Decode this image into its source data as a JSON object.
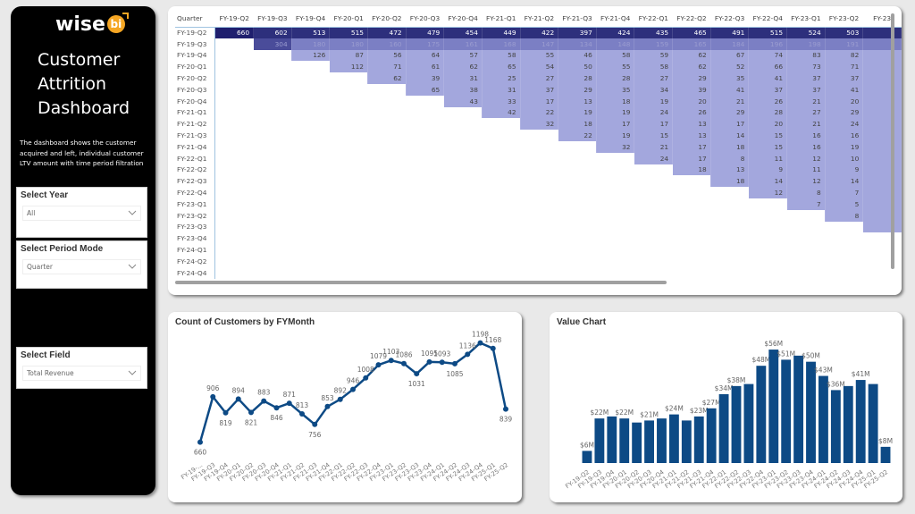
{
  "sidebar": {
    "logo_text": "wise",
    "logo_badge": "bi",
    "title_lines": [
      "Customer",
      "Attrition",
      "Dashboard"
    ],
    "description": "The dashboard shows the customer acquired and left, individual customer LTV amount with time period filtration",
    "slicers": [
      {
        "label": "Select Year",
        "value": "All"
      },
      {
        "label": "Select Period Mode",
        "value": "Quarter"
      },
      {
        "label": "Select Field",
        "value": "Total Revenue"
      }
    ]
  },
  "matrix": {
    "corner_label": "Quarter",
    "columns": [
      "FY-19-Q2",
      "FY-19-Q3",
      "FY-19-Q4",
      "FY-20-Q1",
      "FY-20-Q2",
      "FY-20-Q3",
      "FY-20-Q4",
      "FY-21-Q1",
      "FY-21-Q2",
      "FY-21-Q3",
      "FY-21-Q4",
      "FY-22-Q1",
      "FY-22-Q2",
      "FY-22-Q3",
      "FY-22-Q4",
      "FY-23-Q1",
      "FY-23-Q2",
      "FY-23"
    ],
    "rows": [
      {
        "label": "FY-19-Q2",
        "start": 0,
        "values": [
          660,
          602,
          513,
          515,
          472,
          479,
          454,
          449,
          422,
          397,
          424,
          435,
          465,
          491,
          515,
          524,
          503,
          ""
        ]
      },
      {
        "label": "FY-19-Q3",
        "start": 1,
        "values": [
          304,
          180,
          180,
          160,
          175,
          161,
          168,
          147,
          134,
          148,
          159,
          165,
          184,
          196,
          198,
          191,
          ""
        ]
      },
      {
        "label": "FY-19-Q4",
        "start": 2,
        "values": [
          126,
          87,
          56,
          64,
          57,
          58,
          55,
          46,
          58,
          59,
          62,
          67,
          74,
          83,
          82,
          ""
        ]
      },
      {
        "label": "FY-20-Q1",
        "start": 3,
        "values": [
          112,
          71,
          61,
          62,
          65,
          54,
          50,
          55,
          58,
          62,
          52,
          66,
          73,
          71,
          ""
        ]
      },
      {
        "label": "FY-20-Q2",
        "start": 4,
        "values": [
          62,
          39,
          31,
          25,
          27,
          28,
          28,
          27,
          29,
          35,
          41,
          37,
          37,
          ""
        ]
      },
      {
        "label": "FY-20-Q3",
        "start": 5,
        "values": [
          65,
          38,
          31,
          37,
          29,
          35,
          34,
          39,
          41,
          37,
          37,
          41,
          ""
        ]
      },
      {
        "label": "FY-20-Q4",
        "start": 6,
        "values": [
          43,
          33,
          17,
          13,
          18,
          19,
          20,
          21,
          26,
          21,
          20,
          ""
        ]
      },
      {
        "label": "FY-21-Q1",
        "start": 7,
        "values": [
          42,
          22,
          19,
          19,
          24,
          26,
          29,
          28,
          27,
          29,
          ""
        ]
      },
      {
        "label": "FY-21-Q2",
        "start": 8,
        "values": [
          32,
          18,
          17,
          17,
          13,
          17,
          20,
          21,
          24,
          ""
        ]
      },
      {
        "label": "FY-21-Q3",
        "start": 9,
        "values": [
          22,
          19,
          15,
          13,
          14,
          15,
          16,
          16,
          ""
        ]
      },
      {
        "label": "FY-21-Q4",
        "start": 10,
        "values": [
          32,
          21,
          17,
          18,
          15,
          16,
          19,
          ""
        ]
      },
      {
        "label": "FY-22-Q1",
        "start": 11,
        "values": [
          24,
          17,
          8,
          11,
          12,
          10,
          ""
        ]
      },
      {
        "label": "FY-22-Q2",
        "start": 12,
        "values": [
          18,
          13,
          9,
          11,
          9,
          ""
        ]
      },
      {
        "label": "FY-22-Q3",
        "start": 13,
        "values": [
          18,
          14,
          12,
          14,
          ""
        ]
      },
      {
        "label": "FY-22-Q4",
        "start": 14,
        "values": [
          12,
          8,
          7,
          ""
        ]
      },
      {
        "label": "FY-23-Q1",
        "start": 15,
        "values": [
          7,
          5,
          ""
        ]
      },
      {
        "label": "FY-23-Q2",
        "start": 16,
        "values": [
          8,
          ""
        ]
      },
      {
        "label": "FY-23-Q3",
        "start": 17,
        "values": [
          ""
        ]
      },
      {
        "label": "FY-23-Q4",
        "start": 18,
        "values": []
      },
      {
        "label": "FY-24-Q1",
        "start": 18,
        "values": []
      },
      {
        "label": "FY-24-Q2",
        "start": 18,
        "values": []
      },
      {
        "label": "FY-24-Q4",
        "start": 18,
        "values": []
      }
    ],
    "colors": {
      "max": "#1f1f6e",
      "high": "#3d3f8f",
      "mid": "#7b7fc4",
      "low": "#a3a7dd"
    }
  },
  "chart_data": [
    {
      "type": "line",
      "title": "Count of Customers by FYMonth",
      "xlabel": "",
      "ylabel": "",
      "categories": [
        "FY-19-...",
        "FY-19-Q3",
        "FY-19-Q4",
        "FY-20-Q1",
        "FY-20-Q2",
        "FY-20-Q3",
        "FY-20-Q4",
        "FY-21-Q1",
        "FY-21-Q2",
        "FY-21-Q3",
        "FY-21-Q4",
        "FY-22-Q1",
        "FY-22-Q2",
        "FY-22-Q3",
        "FY-22-Q4",
        "FY-23-Q1",
        "FY-23-Q2",
        "FY-23-Q3",
        "FY-23-Q4",
        "FY-24-Q1",
        "FY-24-Q2",
        "FY-24-Q3",
        "FY-24-Q4",
        "FY-25-Q1",
        "FY-25-Q2"
      ],
      "values": [
        660,
        906,
        819,
        894,
        821,
        883,
        846,
        871,
        813,
        756,
        853,
        892,
        946,
        1008,
        1079,
        1103,
        1086,
        1031,
        1095,
        1093,
        1085,
        1136,
        1198,
        1168,
        839
      ],
      "labels": [
        "660",
        "906",
        "819",
        "894",
        "821",
        "883",
        "846",
        "871",
        "813",
        "756",
        "853",
        "892",
        "946",
        "1008",
        "1079",
        "1103",
        "1086",
        "1031",
        "1095",
        "1093",
        "1085",
        "1136",
        "1198",
        "1168",
        "839"
      ],
      "ylim": [
        600,
        1230
      ],
      "color": "#0d4a85",
      "grid": false
    },
    {
      "type": "bar",
      "title": "Value Chart",
      "xlabel": "",
      "ylabel": "",
      "categories": [
        "FY-19-Q2",
        "FY-19-Q3",
        "FY-19-Q4",
        "FY-20-Q1",
        "FY-20-Q2",
        "FY-20-Q3",
        "FY-20-Q4",
        "FY-21-Q1",
        "FY-21-Q2",
        "FY-21-Q3",
        "FY-21-Q4",
        "FY-22-Q1",
        "FY-22-Q2",
        "FY-22-Q3",
        "FY-22-Q4",
        "FY-23-Q1",
        "FY-23-Q2",
        "FY-23-Q3",
        "FY-23-Q4",
        "FY-24-Q1",
        "FY-24-Q2",
        "FY-24-Q3",
        "FY-24-Q4",
        "FY-25-Q1",
        "FY-25-Q2"
      ],
      "values": [
        6,
        22,
        23,
        22,
        20,
        21,
        22,
        24,
        21,
        23,
        27,
        34,
        38,
        39,
        48,
        56,
        51,
        53,
        50,
        43,
        36,
        38,
        41,
        39,
        8
      ],
      "labels": [
        "$6M",
        "$22M",
        "",
        "$22M",
        "",
        "$21M",
        "",
        "$24M",
        "",
        "$23M",
        "$27M",
        "$34M",
        "$38M",
        "",
        "$48M",
        "$56M",
        "$51M",
        "",
        "$50M",
        "$43M",
        "$36M",
        "",
        "$41M",
        "",
        "$8M"
      ],
      "unit": "$M",
      "ylim": [
        0,
        60
      ],
      "color": "#0d4a85",
      "grid": false
    }
  ]
}
